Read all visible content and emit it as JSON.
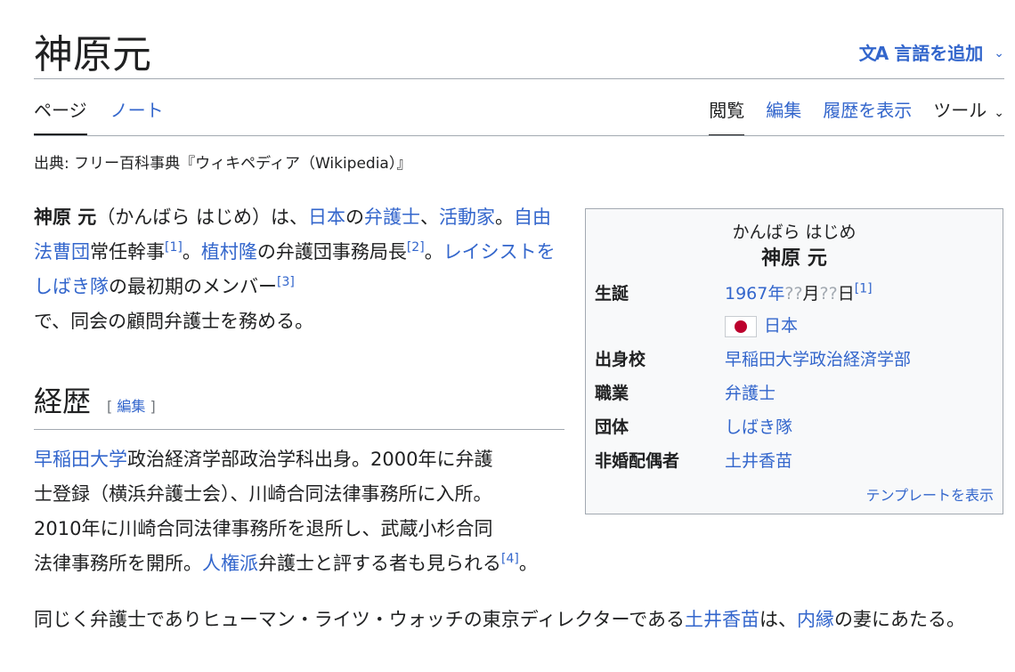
{
  "header": {
    "title": "神原元",
    "lang_icon": "文A",
    "lang_label": "言語を追加",
    "lang_chevron": "⌄"
  },
  "tabs": {
    "left": [
      {
        "label": "ページ"
      },
      {
        "label": "ノート"
      }
    ],
    "right": [
      {
        "label": "閲覧"
      },
      {
        "label": "編集"
      },
      {
        "label": "履歴を表示"
      },
      {
        "label": "ツール"
      }
    ]
  },
  "from_line": "出典: フリー百科事典『ウィキペディア（Wikipedia）』",
  "intro": {
    "bold_name": "神原 元",
    "reading": "（かんばら はじめ）は、",
    "link_japan": "日本",
    "no": "の",
    "link_lawyer": "弁護士",
    "comma": "、",
    "link_activist": "活動家",
    "period": "。",
    "link_jiyuhoso": "自由法曹団",
    "text_jonin": "常任幹事",
    "ref1": "[1]",
    "period2": "。",
    "link_uemura": "植村隆",
    "text_bengodan": "の弁護団事務局長",
    "ref2": "[2]",
    "period3": "。",
    "link_shibaki": "レイシストをしばき隊",
    "text_member": "の最初期のメンバー",
    "ref3": "[3]",
    "text_end": "で、同会の顧問弁護士を務める。"
  },
  "section": {
    "heading": "経歴",
    "edit_open": "[ ",
    "edit_label": "編集",
    "edit_close": " ]"
  },
  "career": {
    "link_waseda": "早稲田大学",
    "line1_rest": "政治経済学部政治学科出身。2000年に弁護",
    "line2": "士登録（横浜弁護士会）、川崎合同法律事務所に入所。",
    "line3": "2010年に川崎合同法律事務所を退所し、武蔵小杉合同",
    "line4_a": "法律事務所を開所。",
    "link_jinken": "人権派",
    "line4_b": "弁護士と評する者も見られる",
    "ref4": "[4]",
    "line4_end": "。"
  },
  "para2": {
    "text_a": "同じく弁護士でありヒューマン・ライツ・ウォッチの東京ディレクターである",
    "link_doi": "土井香苗",
    "text_b": "は、",
    "link_naien": "内縁",
    "text_c": "の妻にあたる。"
  },
  "infobox": {
    "kana": "かんばら はじめ",
    "name": "神原 元",
    "rows": [
      {
        "label": "生誕",
        "value": "1967年"
      },
      {
        "label": "出身校",
        "value": "早稲田大学政治経済学部"
      },
      {
        "label": "職業",
        "value": "弁護士"
      },
      {
        "label": "団体",
        "value": "しばき隊"
      },
      {
        "label": "非婚配偶者",
        "value": "土井香苗"
      }
    ],
    "birth_q1": "??",
    "birth_month": "月",
    "birth_q2": "??",
    "birth_day": "日",
    "birth_ref": "[1]",
    "birth_country": "日本",
    "flag_icon": "japan-flag-icon",
    "template_link": "テンプレートを表示"
  }
}
